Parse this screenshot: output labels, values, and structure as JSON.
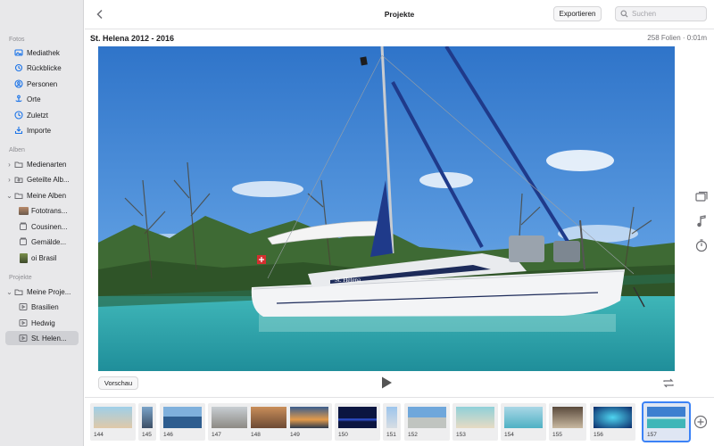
{
  "sidebar": {
    "sections": [
      {
        "title": "Fotos"
      },
      {
        "title": "Alben"
      },
      {
        "title": "Projekte"
      }
    ],
    "fotos": [
      {
        "label": "Mediathek",
        "icon": "photo-library-icon"
      },
      {
        "label": "Rückblicke",
        "icon": "memories-icon"
      },
      {
        "label": "Personen",
        "icon": "people-icon"
      },
      {
        "label": "Orte",
        "icon": "places-pin-icon"
      },
      {
        "label": "Zuletzt",
        "icon": "recent-clock-icon"
      },
      {
        "label": "Importe",
        "icon": "import-icon"
      }
    ],
    "alben": [
      {
        "label": "Medienarten",
        "icon": "folder-icon"
      },
      {
        "label": "Geteilte Alb...",
        "icon": "shared-album-icon"
      },
      {
        "label": "Meine Alben",
        "icon": "folder-icon"
      },
      {
        "label": "Fototrans...",
        "icon": "album-thumbnail-icon"
      },
      {
        "label": "Cousinen...",
        "icon": "album-icon"
      },
      {
        "label": "Gemälde...",
        "icon": "album-icon"
      },
      {
        "label": "oi Brasil",
        "icon": "album-thumbnail-icon"
      }
    ],
    "projekte": [
      {
        "label": "Meine Proje...",
        "icon": "folder-icon"
      },
      {
        "label": "Brasilien",
        "icon": "slideshow-icon"
      },
      {
        "label": "Hedwig",
        "icon": "slideshow-icon"
      },
      {
        "label": "St. Helen...",
        "icon": "slideshow-icon"
      }
    ]
  },
  "toolbar": {
    "title": "Projekte",
    "export_label": "Exportieren",
    "search_placeholder": "Suchen"
  },
  "project": {
    "title": "St. Helena 2012 - 2016",
    "meta": "258 Folien · 0:01m",
    "boat_name": "St. Helena"
  },
  "controls": {
    "preview_label": "Vorschau"
  },
  "filmstrip": {
    "slides": [
      {
        "number": "144"
      },
      {
        "number": "145"
      },
      {
        "number": "146"
      },
      {
        "number": "147"
      },
      {
        "number": "148"
      },
      {
        "number": "149"
      },
      {
        "number": "150"
      },
      {
        "number": "151"
      },
      {
        "number": "152"
      },
      {
        "number": "153"
      },
      {
        "number": "154"
      },
      {
        "number": "155"
      },
      {
        "number": "156"
      },
      {
        "number": "157"
      }
    ],
    "selected": "157"
  },
  "colors": {
    "accent": "#1a73e8",
    "sidebar_bg": "#e8e8ea",
    "selection": "#3b82f6"
  }
}
